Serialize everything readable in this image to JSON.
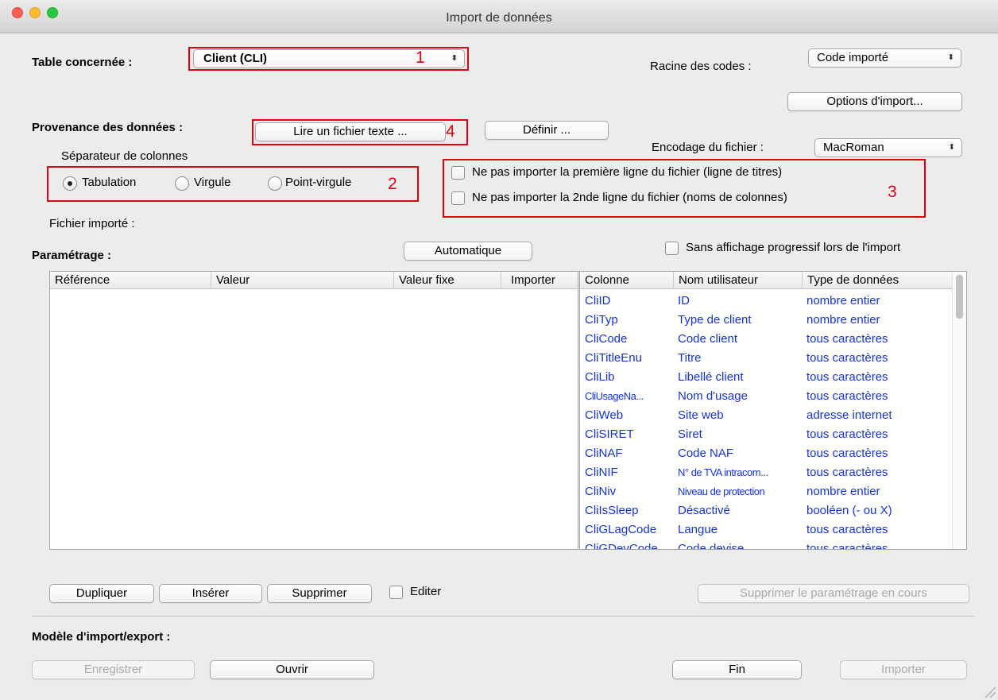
{
  "window": {
    "title": "Import de données"
  },
  "table_section": {
    "label": "Table concernée :",
    "select_value": "Client  (CLI)",
    "annotation": "1"
  },
  "codes_root": {
    "label": "Racine des codes :",
    "select_value": "Code importé"
  },
  "options_button": "Options d'import...",
  "source": {
    "label": "Provenance des données :",
    "read_button": "Lire un fichier texte ...",
    "annotation": "4",
    "define_button": "Définir ..."
  },
  "encoding": {
    "label": "Encodage du fichier :",
    "select_value": "MacRoman"
  },
  "separator": {
    "label": "Séparateur de colonnes",
    "options": [
      "Tabulation",
      "Virgule",
      "Point-virgule"
    ],
    "selected": "Tabulation",
    "annotation": "2"
  },
  "skip_lines": {
    "first_line": "Ne pas importer la première ligne du fichier (ligne de titres)",
    "second_line": "Ne pas importer la 2nde ligne du fichier (noms de colonnes)",
    "annotation": "3"
  },
  "imported_file_label": "Fichier importé :",
  "settings": {
    "label": "Paramétrage :",
    "auto_button": "Automatique",
    "no_progress_checkbox": "Sans affichage progressif lors de l'import"
  },
  "mapping_table": {
    "columns": [
      "Référence",
      "Valeur",
      "Valeur fixe",
      "Importer"
    ],
    "rows": []
  },
  "fields_table": {
    "columns": [
      "Colonne",
      "Nom utilisateur",
      "Type de données"
    ],
    "rows": [
      [
        "CliID",
        "ID",
        "nombre entier"
      ],
      [
        "CliTyp",
        "Type de client",
        "nombre entier"
      ],
      [
        "CliCode",
        "Code client",
        "tous caractères"
      ],
      [
        "CliTitleEnu",
        "Titre",
        "tous caractères"
      ],
      [
        "CliLib",
        "Libellé client",
        "tous caractères"
      ],
      [
        "CliUsageNa...",
        "Nom d'usage",
        "tous caractères"
      ],
      [
        "CliWeb",
        "Site web",
        "adresse internet"
      ],
      [
        "CliSIRET",
        "Siret",
        "tous caractères"
      ],
      [
        "CliNAF",
        "Code NAF",
        "tous caractères"
      ],
      [
        "CliNIF",
        "N° de TVA intracom...",
        "tous caractères"
      ],
      [
        "CliNiv",
        "Niveau de protection",
        "nombre entier"
      ],
      [
        "CliIsSleep",
        "Désactivé",
        "booléen (- ou X)"
      ],
      [
        "CliGLagCode",
        "Langue",
        "tous caractères"
      ],
      [
        "CliGDevCode",
        "Code devise",
        "tous caractères"
      ]
    ]
  },
  "row_actions": {
    "duplicate": "Dupliquer",
    "insert": "Insérer",
    "delete": "Supprimer",
    "edit_checkbox": "Editer",
    "delete_settings": "Supprimer le paramétrage en cours"
  },
  "model": {
    "label": "Modèle d'import/export :",
    "save": "Enregistrer",
    "open": "Ouvrir",
    "finish": "Fin",
    "import": "Importer"
  },
  "colors": {
    "annotation_red": "#e3000f",
    "field_blue": "#1432e6"
  }
}
